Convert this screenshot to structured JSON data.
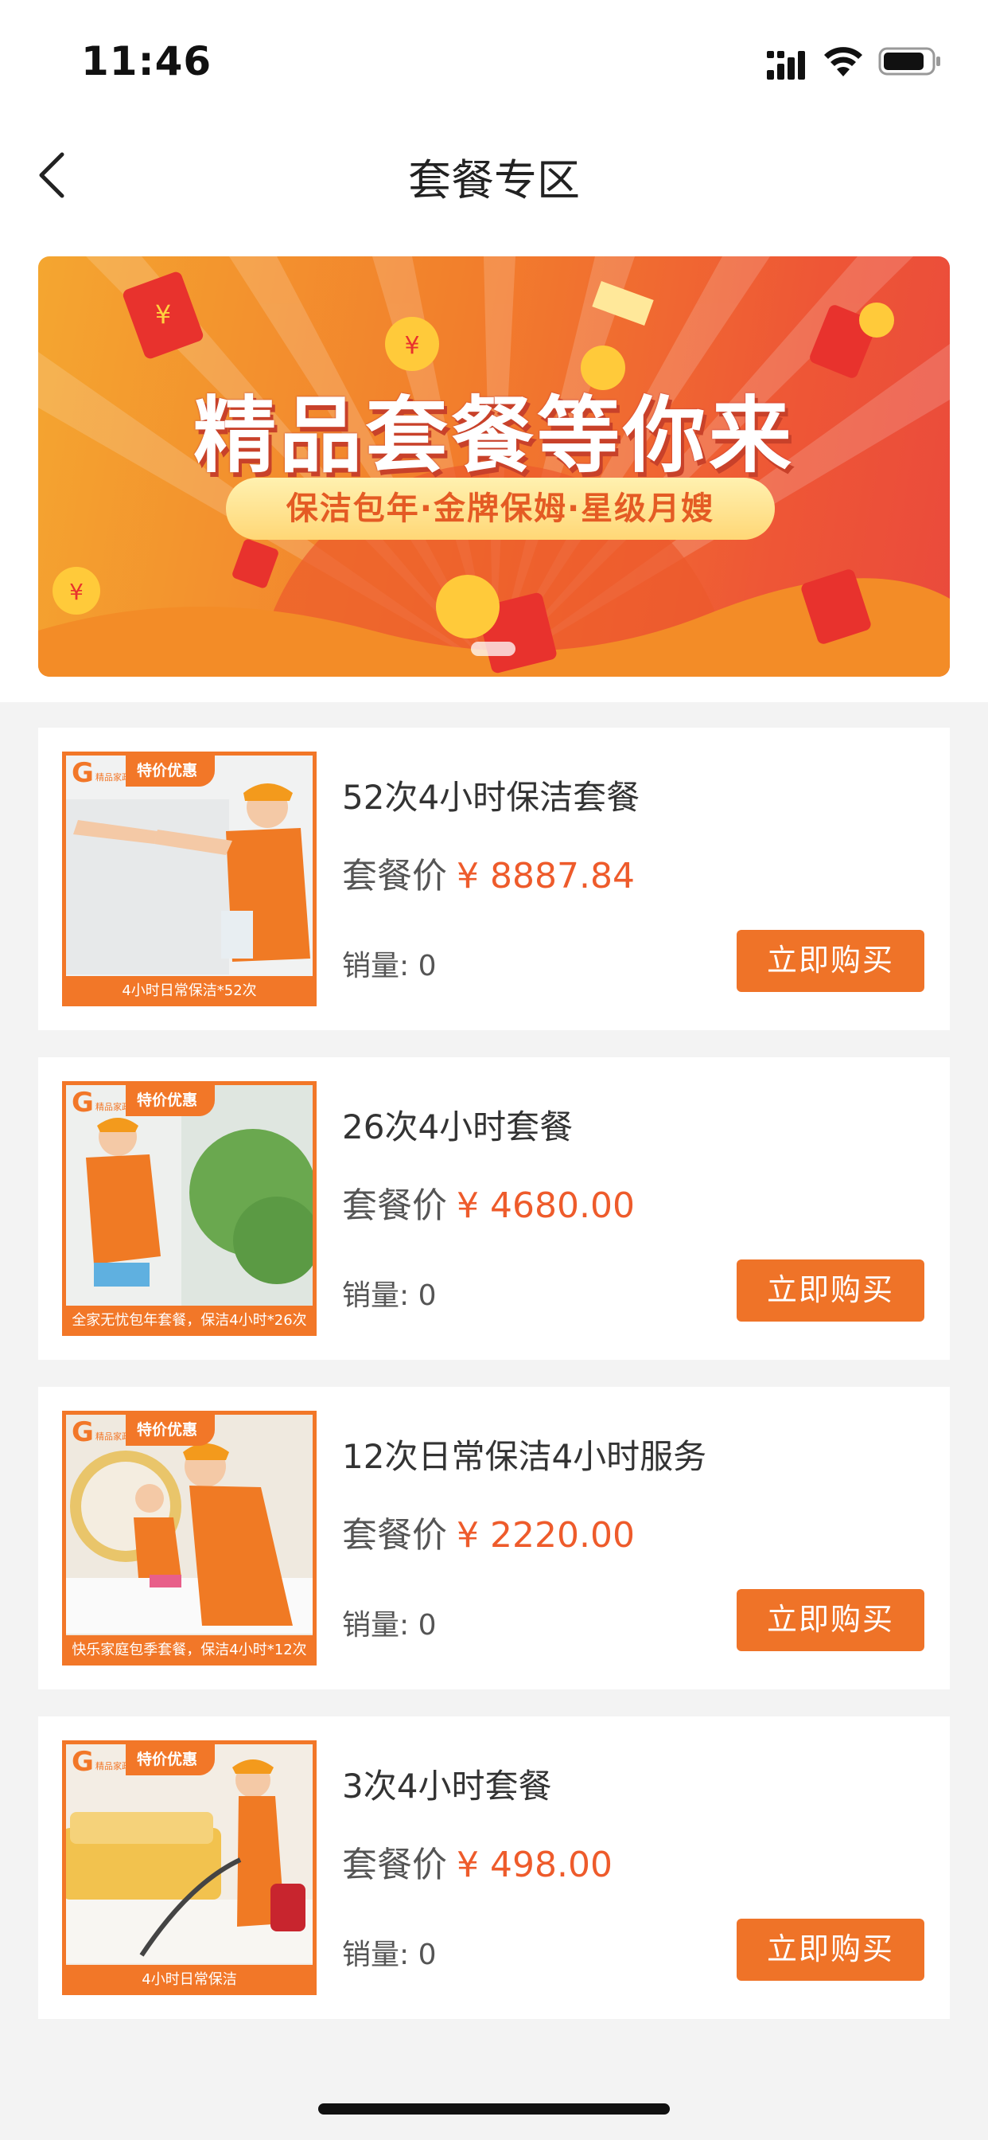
{
  "status_bar": {
    "time": "11:46"
  },
  "nav": {
    "title": "套餐专区"
  },
  "banner": {
    "headline": "精品套餐等你来",
    "subline": "保洁包年·金牌保姆·星级月嫂",
    "currency_symbol": "¥",
    "gradient": [
      "#f4a630",
      "#ee5636"
    ]
  },
  "price_label": "套餐价",
  "buy_label": "立即购买",
  "thumb_tag": "特价优惠",
  "logo_text": "精品家政",
  "colors": {
    "accent": "#ef7328",
    "price": "#ee5b2b"
  },
  "packages": [
    {
      "title": "52次4小时保洁套餐",
      "price": "¥ 8887.84",
      "sales": "销量: 0",
      "caption": "4小时日常保洁*52次"
    },
    {
      "title": "26次4小时套餐",
      "price": "¥ 4680.00",
      "sales": "销量: 0",
      "caption": "全家无忧包年套餐，保洁4小时*26次"
    },
    {
      "title": "12次日常保洁4小时服务",
      "price": "¥ 2220.00",
      "sales": "销量: 0",
      "caption": "快乐家庭包季套餐，保洁4小时*12次"
    },
    {
      "title": "3次4小时套餐",
      "price": "¥ 498.00",
      "sales": "销量: 0",
      "caption": "4小时日常保洁"
    }
  ]
}
